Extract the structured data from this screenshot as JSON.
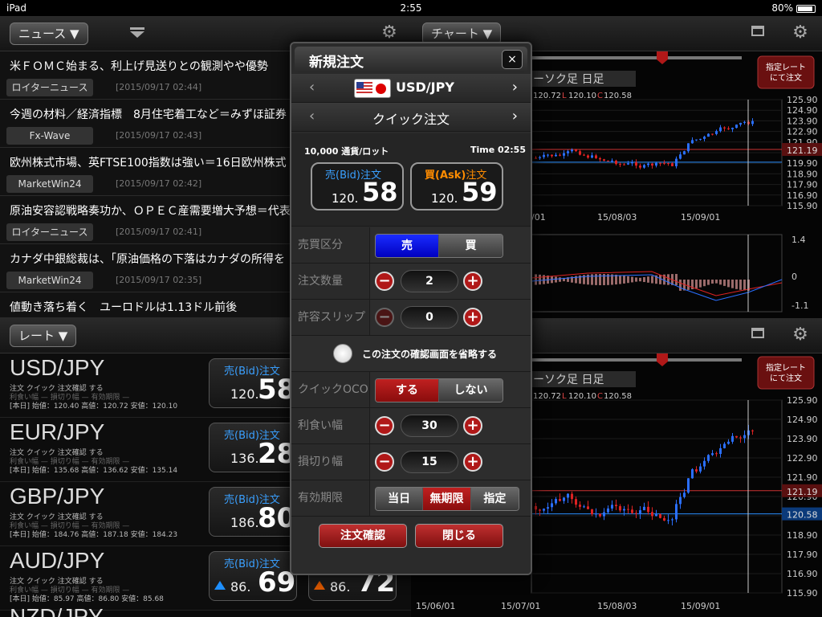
{
  "status": {
    "device": "iPad",
    "time": "2:55",
    "battery": "80%"
  },
  "news": {
    "header_label": "ニュース ▼",
    "items": [
      {
        "title": "米ＦＯＭＣ始まる、利上げ見送りとの観測やや優勢",
        "source": "ロイターニュース",
        "date": "[2015/09/17 02:44]"
      },
      {
        "title": "今週の材料／経済指標　8月住宅着工など＝みずほ証券",
        "source": "Fx-Wave",
        "date": "[2015/09/17 02:43]"
      },
      {
        "title": "欧州株式市場、英FTSE100指数は強い＝16日欧州株式",
        "source": "MarketWin24",
        "date": "[2015/09/17 02:42]"
      },
      {
        "title": "原油安容認戦略奏功か、ＯＰＥＣ産需要増大予想＝代表",
        "source": "ロイターニュース",
        "date": "[2015/09/17 02:41]"
      },
      {
        "title": "カナダ中銀総裁は、「原油価格の下落はカナダの所得を",
        "source": "MarketWin24",
        "date": "[2015/09/17 02:35]"
      },
      {
        "title": "値動き落ち着く　ユーロドルは1.13ドル前後",
        "source": "",
        "date": ""
      }
    ]
  },
  "rates": {
    "header_label": "レート ▼",
    "rows": [
      {
        "pair": "USD/JPY",
        "line1": "注文  クイック            注文確認  する",
        "line2": "利食い幅 —    損切り幅 —    有効期限 —",
        "line3": "[本日]  始値：120.40     高値：120.72     安値：120.10",
        "bid_label": "売(Bid)注文",
        "bid_small": "120.",
        "bid_big": "58"
      },
      {
        "pair": "EUR/JPY",
        "line1": "注文  クイック            注文確認  する",
        "line2": "利食い幅 —    損切り幅 —    有効期限 —",
        "line3": "[本日]  始値：135.68     高値：136.62     安値：135.14",
        "bid_label": "売(Bid)注文",
        "bid_small": "136.",
        "bid_big": "28"
      },
      {
        "pair": "GBP/JPY",
        "line1": "注文  クイック            注文確認  する",
        "line2": "利食い幅 —    損切り幅 —    有効期限 —",
        "line3": "[本日]  始値：184.76     高値：187.18     安値：184.23",
        "bid_label": "売(Bid)注文",
        "bid_small": "186.",
        "bid_big": "80"
      },
      {
        "pair": "AUD/JPY",
        "line1": "注文  クイック            注文確認  する",
        "line2": "利食い幅 —    損切り幅 —    有効期限 —",
        "line3": "[本日]  始値：85.97      高値：86.80      安値：85.68",
        "bid_label": "売(Bid)注文",
        "bid_small": "86.",
        "bid_big": "69",
        "ask_small": "86.",
        "ask_big": "72"
      }
    ],
    "partial_pair": "NZD/JPY"
  },
  "chart": {
    "header_label": "チャート ▼",
    "rate_button": "指定レート\nにて注文",
    "candle_label": "ーソク足 日足",
    "ohlc": {
      "h": "120.72",
      "l_label": "L",
      "l": "120.10",
      "c_label": "C",
      "c": "120.58"
    },
    "yticks": [
      "125.90",
      "124.90",
      "123.90",
      "122.90",
      "121.90",
      "120.90",
      "119.90",
      "118.90",
      "117.90",
      "116.90",
      "115.90"
    ],
    "current_price": "121.19",
    "blue_price": "120.58",
    "xticks_top": [
      "/01",
      "15/08/03",
      "15/09/01"
    ],
    "xticks_bottom": [
      "15/06/01",
      "15/07/01",
      "15/08/03",
      "15/09/01"
    ],
    "macd_ticks": [
      "1.4",
      "0",
      "-1.1"
    ]
  },
  "modal": {
    "title": "新規注文",
    "close": "×",
    "pair": "USD/JPY",
    "order_type": "クイック注文",
    "lot": "10,000 通貨/ロット",
    "time": "Time 02:55",
    "bid": {
      "label_a": "売(Bid)",
      "label_b": "注文",
      "small": "120.",
      "big": "58"
    },
    "ask": {
      "label_a": "買(Ask)",
      "label_b": "注文",
      "small": "120.",
      "big": "59"
    },
    "side_label": "売買区分",
    "sell": "売",
    "buy": "買",
    "qty_label": "注文数量",
    "qty": "2",
    "slip_label": "許容スリップ",
    "slip": "0",
    "skip_confirm": "この注文の確認画面を省略する",
    "oco_label": "クイックOCO",
    "oco_on": "する",
    "oco_off": "しない",
    "tp_label": "利食い幅",
    "tp": "30",
    "sl_label": "損切り幅",
    "sl": "15",
    "exp_label": "有効期限",
    "exp_today": "当日",
    "exp_none": "無期限",
    "exp_set": "指定",
    "confirm": "注文確認",
    "close_btn": "閉じる"
  },
  "colors": {
    "bid_blue": "#3aa0ff",
    "ask_orange": "#ff8c00",
    "red": "#b01818",
    "blue_seg": "#1a2cff"
  }
}
